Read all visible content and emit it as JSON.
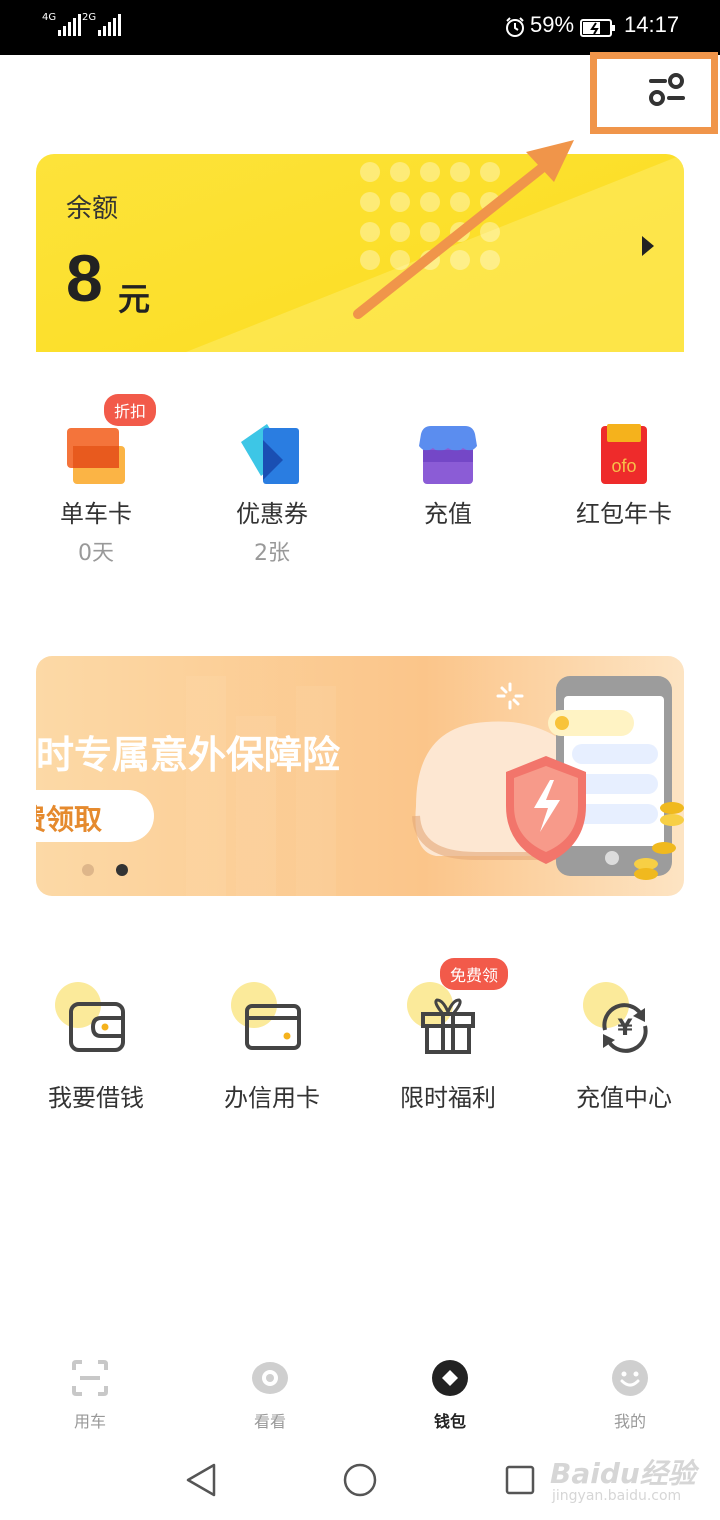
{
  "status_bar": {
    "signal1_tag": "4G",
    "signal2_tag": "2G",
    "battery": "59%",
    "time": "14:17"
  },
  "balance": {
    "label": "余额",
    "amount": "8",
    "unit": "元"
  },
  "quick_actions": [
    {
      "label": "单车卡",
      "sub": "0天",
      "badge": "折扣"
    },
    {
      "label": "优惠券",
      "sub": "2张"
    },
    {
      "label": "充值"
    },
    {
      "label": "红包年卡",
      "icon_text": "ofo"
    }
  ],
  "banner": {
    "title": "时专属意外保障险",
    "button": "费领取",
    "page_count": 2,
    "active_page": 2
  },
  "services": [
    {
      "label": "我要借钱",
      "icon": "wallet-icon"
    },
    {
      "label": "办信用卡",
      "icon": "credit-card-icon"
    },
    {
      "label": "限时福利",
      "icon": "gift-icon",
      "badge": "免费领"
    },
    {
      "label": "充值中心",
      "icon": "yuan-exchange-icon",
      "glyph": "¥"
    }
  ],
  "tabs": [
    {
      "label": "用车",
      "icon": "scan-icon"
    },
    {
      "label": "看看",
      "icon": "eye-icon"
    },
    {
      "label": "钱包",
      "icon": "wallet-tab-icon",
      "active": true
    },
    {
      "label": "我的",
      "icon": "smiley-icon"
    }
  ],
  "watermark": {
    "main": "Baidu经验",
    "sub": "jingyan.baidu.com"
  },
  "colors": {
    "accent_yellow": "#fbdc1c",
    "highlight_orange": "#f0954a",
    "badge_red": "#f25a4a"
  }
}
